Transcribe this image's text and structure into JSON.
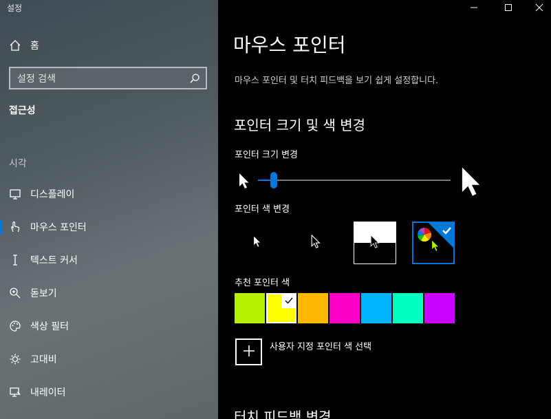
{
  "app": {
    "title": "설정"
  },
  "sidebar": {
    "home_label": "홈",
    "search_placeholder": "설정 검색",
    "section_title": "접근성",
    "group_label": "시각",
    "items": [
      {
        "label": "디스플레이",
        "icon": "monitor-icon"
      },
      {
        "label": "마우스 포인터",
        "icon": "mouse-pointer-icon",
        "selected": true
      },
      {
        "label": "텍스트 커서",
        "icon": "text-cursor-icon"
      },
      {
        "label": "돋보기",
        "icon": "magnifier-icon"
      },
      {
        "label": "색상 필터",
        "icon": "palette-icon"
      },
      {
        "label": "고대비",
        "icon": "brightness-icon"
      },
      {
        "label": "내레이터",
        "icon": "narrator-icon"
      }
    ]
  },
  "window_controls": [
    "minimize-icon",
    "maximize-icon",
    "close-icon"
  ],
  "main": {
    "title": "마우스 포인터",
    "description": "마우스 포인터 및 터치 피드백을 보기 쉽게 설정합니다.",
    "section_pointer": "포인터 크기 및 색 변경",
    "size_label": "포인터 크기 변경",
    "size_value_fraction": 0.08,
    "color_label": "포인터 색 변경",
    "color_options": [
      "white",
      "black",
      "inverted",
      "custom"
    ],
    "selected_color_option": "custom",
    "recommended_label": "추천 포인터 색",
    "recommended_colors": [
      "#b4f000",
      "#ffff00",
      "#ffb900",
      "#ff00c8",
      "#00b4ff",
      "#00ffc0",
      "#c800ff"
    ],
    "selected_recommended": 1,
    "custom_label": "사용자 지정 포인터 색 선택",
    "section_touch": "터치 피드백 변경"
  },
  "accent": "#0078d7"
}
